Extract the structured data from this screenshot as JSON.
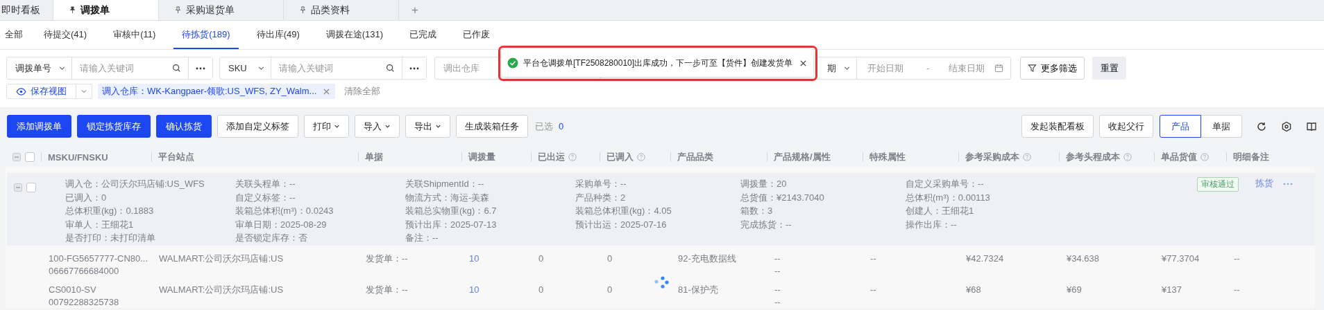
{
  "page_tabs": [
    {
      "label": "即时看板",
      "pinned": false,
      "selected": false
    },
    {
      "label": "调拨单",
      "pinned": true,
      "selected": true
    },
    {
      "label": "采购退货单",
      "pinned": true,
      "selected": false
    },
    {
      "label": "品类资料",
      "pinned": true,
      "selected": false
    }
  ],
  "new_tab": "+",
  "status_tabs": [
    {
      "label": "全部",
      "selected": false
    },
    {
      "label": "待提交(41)",
      "selected": false
    },
    {
      "label": "审核中(11)",
      "selected": false
    },
    {
      "label": "待拣货(189)",
      "selected": true
    },
    {
      "label": "待出库(49)",
      "selected": false
    },
    {
      "label": "调拨在途(131)",
      "selected": false
    },
    {
      "label": "已完成",
      "selected": false
    },
    {
      "label": "已作废",
      "selected": false
    }
  ],
  "filters": [
    {
      "kind": "keyword",
      "select": "调拨单号",
      "placeholder": "请输入关键词"
    },
    {
      "kind": "keyword",
      "select": "SKU",
      "placeholder": "请输入关键词"
    },
    {
      "kind": "select",
      "placeholder": "调出仓库"
    },
    {
      "kind": "select",
      "value": "期"
    },
    {
      "kind": "date_range",
      "start_placeholder": "开始日期",
      "separator": "-",
      "end_placeholder": "结束日期"
    }
  ],
  "more_filters_button": "更多筛选",
  "reset_button": "重置",
  "save_view_button": "保存视图",
  "active_filter_tag": "调入仓库：WK-Kangpaer-领歌:US_WFS, ZY_Walm...",
  "clear_all": "清除全部",
  "toast": {
    "kind": "success",
    "message": "平台仓调拨单[TF2508280010]出库成功，下一步可至【货件】创建发货单"
  },
  "toolbar": {
    "left": [
      {
        "label": "添加调拨单",
        "kind": "primary"
      },
      {
        "label": "锁定拣货库存",
        "kind": "primary"
      },
      {
        "label": "确认拣货",
        "kind": "primary"
      },
      {
        "label": "添加自定义标签",
        "kind": "default"
      },
      {
        "label": "打印",
        "kind": "dropdown"
      },
      {
        "label": "导入",
        "kind": "dropdown"
      },
      {
        "label": "导出",
        "kind": "dropdown"
      },
      {
        "label": "生成装箱任务",
        "kind": "default"
      }
    ],
    "selected_label": "已选",
    "selected_count": "0",
    "right": [
      {
        "label": "发起装配看板"
      },
      {
        "label": "收起父行"
      }
    ],
    "view_switch": [
      {
        "label": "产品",
        "selected": true
      },
      {
        "label": "单据",
        "selected": false
      }
    ]
  },
  "table": {
    "header": {
      "expanded": true,
      "checked": false
    },
    "columns": [
      {
        "label": "MSKU/FNSKU",
        "help": false
      },
      {
        "label": "平台站点",
        "help": false
      },
      {
        "label": "单据",
        "help": false
      },
      {
        "label": "调拨量",
        "help": false
      },
      {
        "label": "已出运",
        "help": true
      },
      {
        "label": "已调入",
        "help": true
      },
      {
        "label": "产品品类",
        "help": false
      },
      {
        "label": "产品规格/属性",
        "help": false
      },
      {
        "label": "特殊属性",
        "help": false
      },
      {
        "label": "参考采购成本",
        "help": true
      },
      {
        "label": "参考头程成本",
        "help": true
      },
      {
        "label": "单品货值",
        "help": true
      },
      {
        "label": "明细备注",
        "help": false
      }
    ],
    "parent": {
      "expanded": true,
      "checked": false,
      "info": [
        [
          "调入仓：公司沃尔玛店铺:US_WFS",
          "已调入：0",
          "总体积重(kg)：0.1883",
          "审单人：王细花1",
          "是否打印：未打印清单"
        ],
        [
          "关联头程单：--",
          "自定义标签：--",
          "装箱总体积(m³)：0.0243",
          "审单日期：2025-08-29",
          "是否锁定库存：否"
        ],
        [
          "关联ShipmentId：--",
          "物流方式：海运-美森",
          "装箱总实物重(kg)：6.7",
          "预计出库：2025-07-13",
          "备注：--"
        ],
        [
          "采购单号：--",
          "产品种类：2",
          "装箱总体积重(kg)：4.05",
          "预计出运：2025-07-16"
        ],
        [
          "调拨量：20",
          "总货值：¥2143.7040",
          "箱数：3",
          "完成拣货：--"
        ],
        [
          "自定义采购单号：--",
          "总体积(m³)：0.00113",
          "创建人：王细花1",
          "操作出库：--"
        ]
      ],
      "status": "审核通过",
      "action": "拣货"
    },
    "rows": [
      {
        "msku": "100-FG5657777-CN80...",
        "fnsku": "06667766684000",
        "site": "WALMART:公司沃尔玛店铺:US",
        "document": "发货单：--",
        "quantity": "10",
        "shipped": "0",
        "received": "0",
        "category": "92-充电数据线",
        "spec": [
          "--",
          "--"
        ],
        "special": "--",
        "purchase_cost": "¥42.7324",
        "freight_cost": "¥34.638",
        "unit_value": "¥77.3704",
        "note": "--"
      },
      {
        "msku": "CS0010-SV",
        "fnsku": "00792288325738",
        "site": "WALMART:公司沃尔玛店铺:US",
        "document": "发货单：--",
        "quantity": "10",
        "shipped": "0",
        "received": "0",
        "category": "81-保护壳",
        "spec": [
          "--",
          "--"
        ],
        "special": "--",
        "purchase_cost": "¥68",
        "freight_cost": "¥69",
        "unit_value": "¥137",
        "note": "--"
      }
    ]
  }
}
